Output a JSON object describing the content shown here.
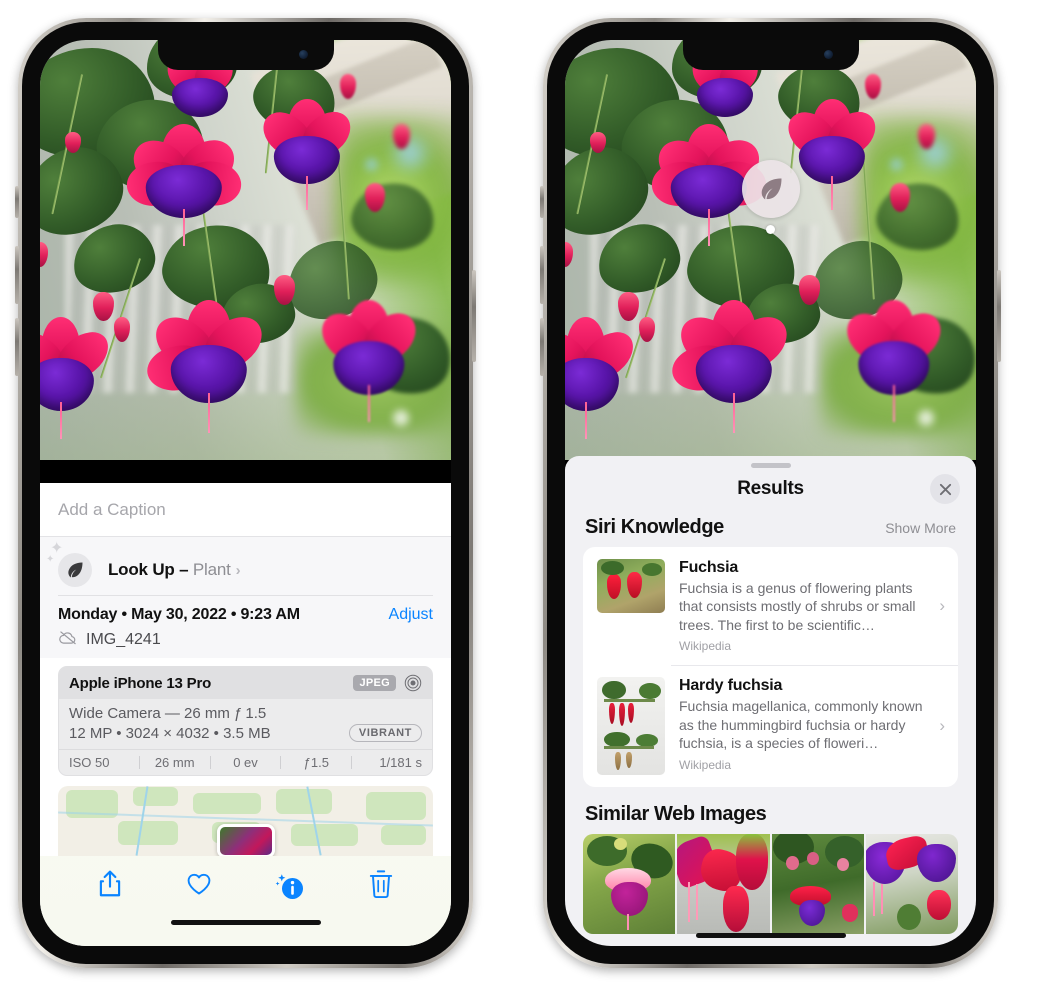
{
  "left_phone": {
    "caption_placeholder": "Add a Caption",
    "lookup": {
      "label": "Look Up – ",
      "subject": "Plant",
      "chevron": "›",
      "icon": "leaf-icon"
    },
    "meta": {
      "date": "Monday • May 30, 2022 • 9:23 AM",
      "adjust_label": "Adjust",
      "filename": "IMG_4241",
      "cloud_icon": "cloud-slash-icon"
    },
    "camera": {
      "device": "Apple iPhone 13 Pro",
      "format_chip": "JPEG",
      "lens_icon": "aperture-icon",
      "lens_line": "Wide Camera — 26 mm ƒ 1.5",
      "spec_line": "12 MP • 3024 × 4032 • 3.5 MB",
      "style_chip": "VIBRANT",
      "exif": [
        "ISO 50",
        "26 mm",
        "0 ev",
        "ƒ1.5",
        "1/181 s"
      ]
    },
    "toolbar": [
      {
        "name": "share-icon",
        "label": "Share"
      },
      {
        "name": "heart-icon",
        "label": "Favorite"
      },
      {
        "name": "info-sparkle-icon",
        "label": "Info"
      },
      {
        "name": "trash-icon",
        "label": "Delete"
      }
    ]
  },
  "right_phone": {
    "visual_lookup_badge": {
      "icon": "leaf-icon"
    },
    "sheet": {
      "title": "Results",
      "close_icon": "close-icon",
      "grabber": "drag-handle"
    },
    "siri_knowledge": {
      "heading": "Siri Knowledge",
      "show_more": "Show More",
      "items": [
        {
          "title": "Fuchsia",
          "description": "Fuchsia is a genus of flowering plants that consists mostly of shrubs or small trees. The first to be scientific…",
          "source": "Wikipedia",
          "chevron": "›"
        },
        {
          "title": "Hardy fuchsia",
          "description": "Fuchsia magellanica, commonly known as the hummingbird fuchsia or hardy fuchsia, is a species of floweri…",
          "source": "Wikipedia",
          "chevron": "›"
        }
      ]
    },
    "similar_web_images": {
      "heading": "Similar Web Images",
      "count": 4
    }
  },
  "colors": {
    "accent_blue": "#0a84ff",
    "sheet_bg": "#f1f1f4",
    "card_bg": "#ffffff",
    "secondary_text": "#8e8e93",
    "chip_gray": "#a9a9ae"
  }
}
